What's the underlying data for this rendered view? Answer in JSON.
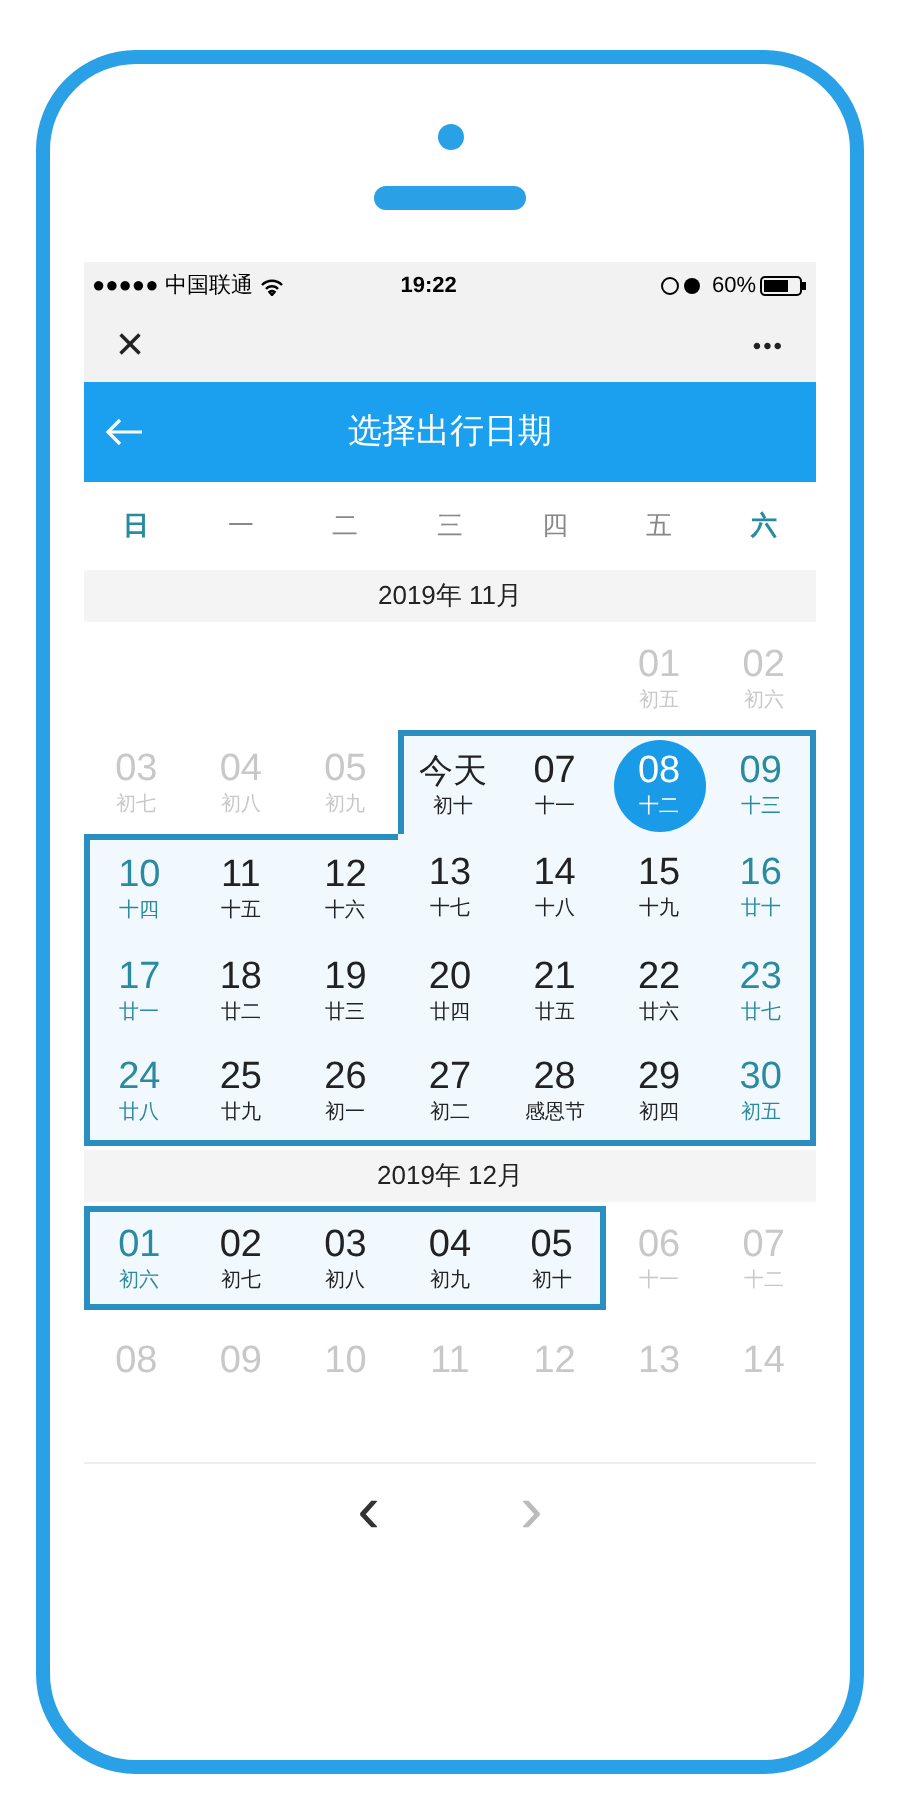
{
  "status_bar": {
    "carrier": "●●●●● 中国联通",
    "time": "19:22",
    "battery": "60%"
  },
  "nav_bar": {
    "close": "×",
    "more": "•••"
  },
  "header": {
    "title": "选择出行日期"
  },
  "weekdays": [
    {
      "label": "日",
      "weekend": true
    },
    {
      "label": "一",
      "weekend": false
    },
    {
      "label": "二",
      "weekend": false
    },
    {
      "label": "三",
      "weekend": false
    },
    {
      "label": "四",
      "weekend": false
    },
    {
      "label": "五",
      "weekend": false
    },
    {
      "label": "六",
      "weekend": true
    }
  ],
  "months": [
    {
      "title": "2019年 11月",
      "weeks": [
        [
          {
            "kind": "blank"
          },
          {
            "kind": "blank"
          },
          {
            "kind": "blank"
          },
          {
            "kind": "blank"
          },
          {
            "kind": "blank"
          },
          {
            "day": "01",
            "lunar": "初五",
            "kind": "muted",
            "in_range": false,
            "selected": false
          },
          {
            "day": "02",
            "lunar": "初六",
            "kind": "muted",
            "in_range": false,
            "selected": false
          }
        ],
        [
          {
            "day": "03",
            "lunar": "初七",
            "kind": "muted",
            "in_range": false,
            "selected": false
          },
          {
            "day": "04",
            "lunar": "初八",
            "kind": "muted",
            "in_range": false,
            "selected": false
          },
          {
            "day": "05",
            "lunar": "初九",
            "kind": "muted",
            "in_range": false,
            "selected": false
          },
          {
            "day": "今天",
            "lunar": "初十",
            "kind": "today",
            "in_range": true,
            "selected": false
          },
          {
            "day": "07",
            "lunar": "十一",
            "kind": "normal",
            "in_range": true,
            "selected": false
          },
          {
            "day": "08",
            "lunar": "十二",
            "kind": "normal",
            "in_range": true,
            "selected": true
          },
          {
            "day": "09",
            "lunar": "十三",
            "kind": "weekend",
            "in_range": true,
            "selected": false
          }
        ],
        [
          {
            "day": "10",
            "lunar": "十四",
            "kind": "weekend",
            "in_range": true,
            "selected": false
          },
          {
            "day": "11",
            "lunar": "十五",
            "kind": "normal",
            "in_range": true,
            "selected": false
          },
          {
            "day": "12",
            "lunar": "十六",
            "kind": "normal",
            "in_range": true,
            "selected": false
          },
          {
            "day": "13",
            "lunar": "十七",
            "kind": "normal",
            "in_range": true,
            "selected": false
          },
          {
            "day": "14",
            "lunar": "十八",
            "kind": "normal",
            "in_range": true,
            "selected": false
          },
          {
            "day": "15",
            "lunar": "十九",
            "kind": "normal",
            "in_range": true,
            "selected": false
          },
          {
            "day": "16",
            "lunar": "廿十",
            "kind": "weekend",
            "in_range": true,
            "selected": false
          }
        ],
        [
          {
            "day": "17",
            "lunar": "廿一",
            "kind": "weekend",
            "in_range": true,
            "selected": false
          },
          {
            "day": "18",
            "lunar": "廿二",
            "kind": "normal",
            "in_range": true,
            "selected": false
          },
          {
            "day": "19",
            "lunar": "廿三",
            "kind": "normal",
            "in_range": true,
            "selected": false
          },
          {
            "day": "20",
            "lunar": "廿四",
            "kind": "normal",
            "in_range": true,
            "selected": false
          },
          {
            "day": "21",
            "lunar": "廿五",
            "kind": "normal",
            "in_range": true,
            "selected": false
          },
          {
            "day": "22",
            "lunar": "廿六",
            "kind": "normal",
            "in_range": true,
            "selected": false
          },
          {
            "day": "23",
            "lunar": "廿七",
            "kind": "weekend",
            "in_range": true,
            "selected": false
          }
        ],
        [
          {
            "day": "24",
            "lunar": "廿八",
            "kind": "weekend",
            "in_range": true,
            "selected": false
          },
          {
            "day": "25",
            "lunar": "廿九",
            "kind": "normal",
            "in_range": true,
            "selected": false
          },
          {
            "day": "26",
            "lunar": "初一",
            "kind": "normal",
            "in_range": true,
            "selected": false
          },
          {
            "day": "27",
            "lunar": "初二",
            "kind": "normal",
            "in_range": true,
            "selected": false
          },
          {
            "day": "28",
            "lunar": "感恩节",
            "kind": "normal",
            "in_range": true,
            "selected": false
          },
          {
            "day": "29",
            "lunar": "初四",
            "kind": "normal",
            "in_range": true,
            "selected": false
          },
          {
            "day": "30",
            "lunar": "初五",
            "kind": "weekend",
            "in_range": true,
            "selected": false
          }
        ]
      ]
    },
    {
      "title": "2019年 12月",
      "weeks": [
        [
          {
            "day": "01",
            "lunar": "初六",
            "kind": "weekend",
            "in_range": true,
            "selected": false
          },
          {
            "day": "02",
            "lunar": "初七",
            "kind": "normal",
            "in_range": true,
            "selected": false
          },
          {
            "day": "03",
            "lunar": "初八",
            "kind": "normal",
            "in_range": true,
            "selected": false
          },
          {
            "day": "04",
            "lunar": "初九",
            "kind": "normal",
            "in_range": true,
            "selected": false
          },
          {
            "day": "05",
            "lunar": "初十",
            "kind": "normal",
            "in_range": true,
            "selected": false
          },
          {
            "day": "06",
            "lunar": "十一",
            "kind": "muted",
            "in_range": false,
            "selected": false
          },
          {
            "day": "07",
            "lunar": "十二",
            "kind": "muted",
            "in_range": false,
            "selected": false
          }
        ],
        [
          {
            "day": "08",
            "kind": "muted",
            "in_range": false,
            "selected": false
          },
          {
            "day": "09",
            "kind": "muted",
            "in_range": false,
            "selected": false
          },
          {
            "day": "10",
            "kind": "muted",
            "in_range": false,
            "selected": false
          },
          {
            "day": "11",
            "kind": "muted",
            "in_range": false,
            "selected": false
          },
          {
            "day": "12",
            "kind": "muted",
            "in_range": false,
            "selected": false
          },
          {
            "day": "13",
            "kind": "muted",
            "in_range": false,
            "selected": false
          },
          {
            "day": "14",
            "kind": "muted",
            "in_range": false,
            "selected": false
          }
        ]
      ]
    }
  ],
  "pager": {
    "prev": "‹",
    "next": "›",
    "next_disabled": true
  }
}
